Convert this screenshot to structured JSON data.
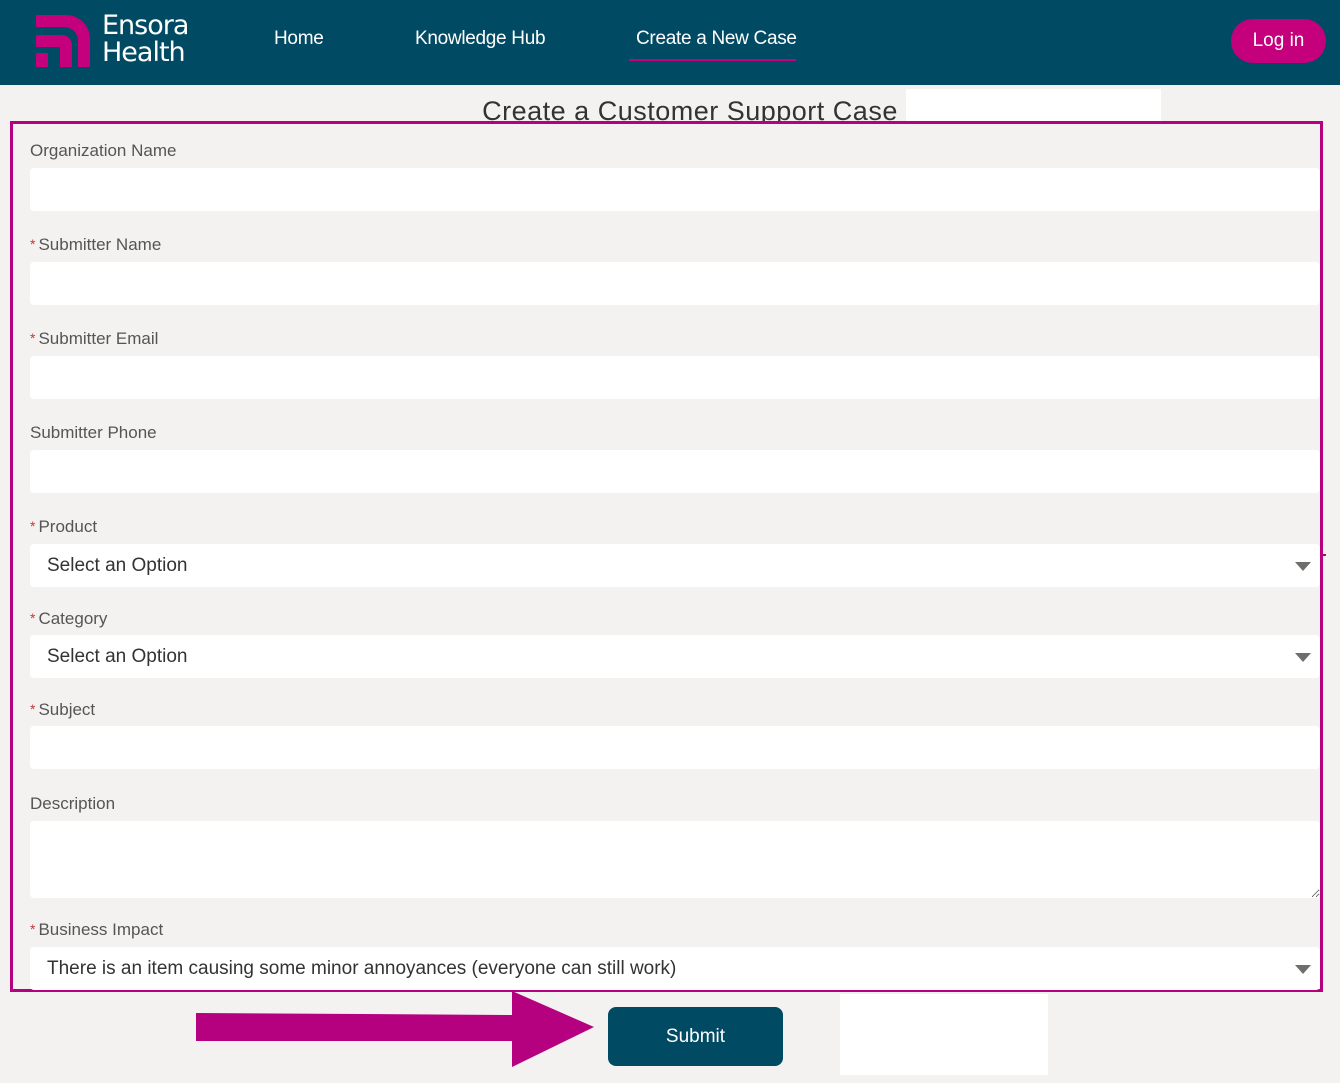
{
  "brand": {
    "line1": "Ensora",
    "line2": "Health"
  },
  "nav": {
    "home": "Home",
    "knowledge_hub": "Knowledge Hub",
    "create_case": "Create a New Case",
    "login": "Log in"
  },
  "page": {
    "title": "Create a Customer Support Case"
  },
  "form": {
    "organization_name": {
      "label": "Organization Name",
      "value": ""
    },
    "submitter_name": {
      "label": "Submitter Name",
      "required": "*",
      "value": ""
    },
    "submitter_email": {
      "label": "Submitter Email",
      "required": "*",
      "value": ""
    },
    "submitter_phone": {
      "label": "Submitter Phone",
      "value": ""
    },
    "product": {
      "label": "Product",
      "required": "*",
      "selected": "Select an Option"
    },
    "category": {
      "label": "Category",
      "required": "*",
      "selected": "Select an Option"
    },
    "subject": {
      "label": "Subject",
      "required": "*",
      "value": ""
    },
    "description": {
      "label": "Description",
      "value": ""
    },
    "business_impact": {
      "label": "Business Impact",
      "required": "*",
      "selected": "There is an item causing some minor annoyances (everyone can still work)"
    },
    "submit_label": "Submit"
  },
  "colors": {
    "header_bg": "#004b63",
    "accent_magenta": "#c4007d",
    "highlight_border": "#b5007f",
    "page_bg": "#f3f2f1"
  },
  "icons": {
    "logo": "ensora-logo-icon",
    "select_caret": "caret-down-icon",
    "annotation_arrow": "arrow-right-icon",
    "resize": "resize-grip-icon"
  }
}
